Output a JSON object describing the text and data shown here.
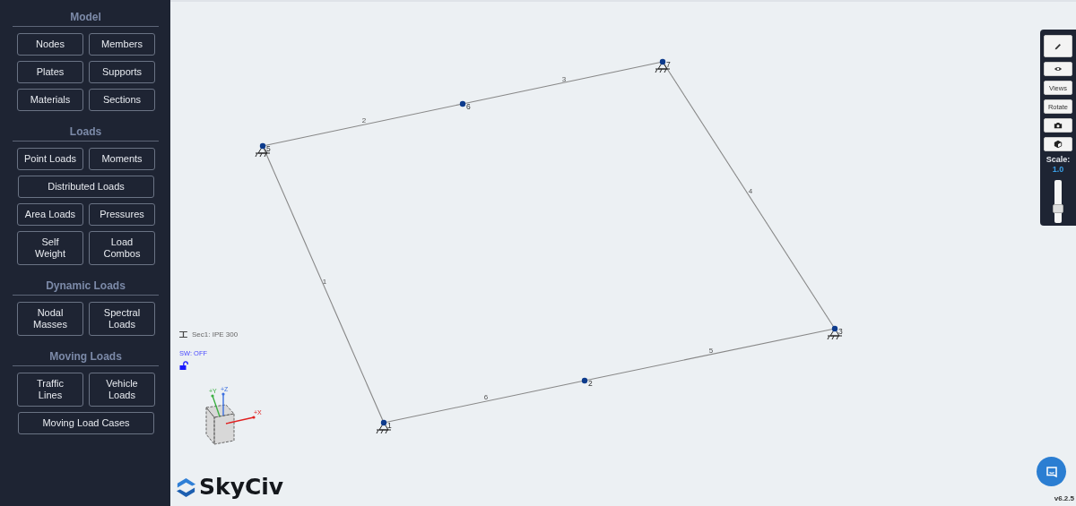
{
  "sidebar": {
    "sections": [
      {
        "title": "Model",
        "buttons": [
          {
            "label": "Nodes",
            "kind": "half"
          },
          {
            "label": "Members",
            "kind": "half"
          },
          {
            "label": "Plates",
            "kind": "half"
          },
          {
            "label": "Supports",
            "kind": "half"
          },
          {
            "label": "Materials",
            "kind": "half"
          },
          {
            "label": "Sections",
            "kind": "half"
          }
        ]
      },
      {
        "title": "Loads",
        "buttons": [
          {
            "label": "Point Loads",
            "kind": "half"
          },
          {
            "label": "Moments",
            "kind": "half"
          },
          {
            "label": "Distributed Loads",
            "kind": "full"
          },
          {
            "label": "Area Loads",
            "kind": "half"
          },
          {
            "label": "Pressures",
            "kind": "half"
          },
          {
            "label": "Self\nWeight",
            "kind": "half"
          },
          {
            "label": "Load\nCombos",
            "kind": "half"
          }
        ]
      },
      {
        "title": "Dynamic Loads",
        "buttons": [
          {
            "label": "Nodal\nMasses",
            "kind": "half"
          },
          {
            "label": "Spectral\nLoads",
            "kind": "half"
          }
        ]
      },
      {
        "title": "Moving Loads",
        "buttons": [
          {
            "label": "Traffic\nLines",
            "kind": "half"
          },
          {
            "label": "Vehicle\nLoads",
            "kind": "half"
          },
          {
            "label": "Moving Load Cases",
            "kind": "full"
          }
        ]
      }
    ]
  },
  "model": {
    "nodes": [
      {
        "label": "1",
        "support": true
      },
      {
        "label": "2",
        "support": false
      },
      {
        "label": "3",
        "support": true
      },
      {
        "label": "5",
        "support": true
      },
      {
        "label": "6",
        "support": false
      },
      {
        "label": "7",
        "support": true
      }
    ],
    "members": [
      {
        "label": "1"
      },
      {
        "label": "2"
      },
      {
        "label": "3"
      },
      {
        "label": "4"
      },
      {
        "label": "5"
      },
      {
        "label": "6"
      }
    ]
  },
  "info": {
    "section": "Sec1: IPE 300",
    "self_weight": "SW: OFF",
    "locked": false
  },
  "axes": {
    "x": "+X",
    "y": "+Y",
    "z": "+Z"
  },
  "logo": "SkyCiv",
  "toolbar": {
    "buttons": [
      {
        "kind": "pencil"
      },
      {
        "kind": "eye"
      },
      {
        "kind": "text",
        "label": "Views"
      },
      {
        "kind": "text",
        "label": "Rotate"
      },
      {
        "kind": "camera"
      },
      {
        "kind": "cube"
      }
    ],
    "scale_label": "Scale:",
    "scale_value": "1.0",
    "level": 0.3
  },
  "version": "v6.2.5"
}
